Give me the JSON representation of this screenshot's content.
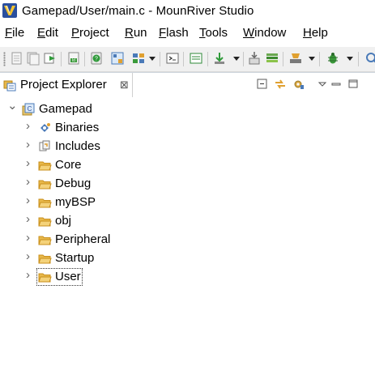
{
  "window": {
    "title": "Gamepad/User/main.c - MounRiver Studio"
  },
  "menu": [
    {
      "label": "File",
      "mnemonic": "F",
      "rest": "ile"
    },
    {
      "label": "Edit",
      "mnemonic": "E",
      "rest": "dit"
    },
    {
      "label": "Project",
      "mnemonic": "P",
      "rest": "roject"
    },
    {
      "label": "Run",
      "mnemonic": "R",
      "rest": "un"
    },
    {
      "label": "Flash",
      "mnemonic": "F",
      "rest": "lash"
    },
    {
      "label": "Tools",
      "mnemonic": "T",
      "rest": "ools"
    },
    {
      "label": "Window",
      "mnemonic": "W",
      "rest": "indow"
    },
    {
      "label": "Help",
      "mnemonic": "H",
      "rest": "elp"
    }
  ],
  "toolbar": {
    "icons": [
      "new-icon",
      "save-icon",
      "save-all-icon",
      "export-icon",
      "build-all-icon",
      "help-icon",
      "download-icon",
      "target-icon",
      "console-icon",
      "monitor-icon",
      "flash-icon",
      "erase-icon",
      "stack-icon",
      "external-tools-icon",
      "debug-icon",
      "search-icon"
    ]
  },
  "explorer": {
    "tab_label": "Project Explorer",
    "tab_close_glyph": "⊠",
    "project": {
      "name": "Gamepad",
      "expanded": true
    },
    "items": [
      {
        "label": "Binaries",
        "icon": "binaries-icon"
      },
      {
        "label": "Includes",
        "icon": "includes-icon"
      },
      {
        "label": "Core",
        "icon": "folder-icon"
      },
      {
        "label": "Debug",
        "icon": "folder-icon"
      },
      {
        "label": "myBSP",
        "icon": "folder-icon"
      },
      {
        "label": "obj",
        "icon": "folder-icon"
      },
      {
        "label": "Peripheral",
        "icon": "folder-icon"
      },
      {
        "label": "Startup",
        "icon": "folder-icon"
      },
      {
        "label": "User",
        "icon": "folder-icon"
      }
    ],
    "twisty_collapsed": "›",
    "twisty_expanded": "⌄"
  },
  "colors": {
    "folder": "#e8b84a",
    "folder_dark": "#c98f1b",
    "accent": "#3c6fb4"
  }
}
